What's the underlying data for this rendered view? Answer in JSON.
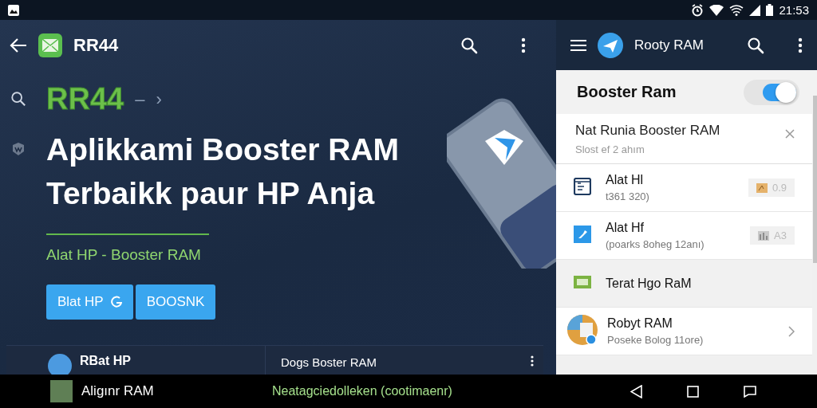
{
  "status_bar": {
    "time": "21:53"
  },
  "main": {
    "toolbar": {
      "title": "RR44"
    },
    "brand": {
      "name": "RR44",
      "dash": "–",
      "chevron": "›"
    },
    "headline": [
      "Aplikkami Booster RAM",
      "Terbaikk paur HP Anja"
    ],
    "subtitle": "Alat HP - Booster RAM",
    "buttons": [
      {
        "label": "Blat HP"
      },
      {
        "label": "BOOSNK"
      }
    ],
    "card": {
      "column_1": "RBat HP",
      "column_2": "Dogs Boster RAM"
    }
  },
  "panel": {
    "app_bar": {
      "title": "Rooty RAM"
    },
    "toggle": {
      "label": "Booster Ram",
      "on": true
    },
    "notification": {
      "title": "Nat Runia Booster RAM",
      "subtitle": "Slost ef 2 ahım"
    },
    "items": [
      {
        "kind": "badge",
        "title": "Alat Hl",
        "subtitle": "t361 320)",
        "badge": "0.9",
        "selected": false
      },
      {
        "kind": "badge",
        "title": "Alat Hf",
        "subtitle": "(poarks 8oheg 12anı)",
        "badge": "A3",
        "selected": false
      },
      {
        "kind": "plain",
        "title": "Terat Hgo RaM",
        "selected": true
      },
      {
        "kind": "chevron",
        "title": "Robyt RAM",
        "subtitle": "Poseke Bolog 11ore)",
        "selected": false
      }
    ]
  },
  "nav_bar": {
    "title": "Aligınr RAM",
    "caption": "Neatagciedolleken (cootimaenr)"
  }
}
